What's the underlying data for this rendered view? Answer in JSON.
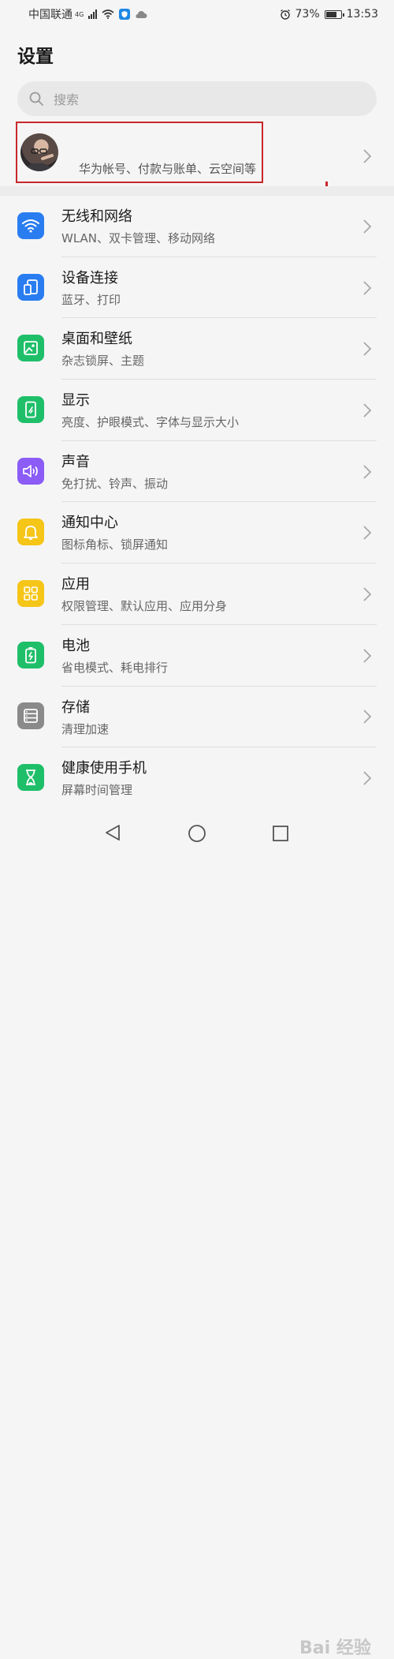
{
  "status_bar": {
    "carrier": "中国联通",
    "network": "4G",
    "battery_percent": "73%",
    "battery_level": 0.73,
    "time": "13:53",
    "icons": [
      "signal-icon",
      "wifi-icon",
      "shield-app-icon",
      "cloud-icon",
      "alarm-icon",
      "battery-icon"
    ]
  },
  "header": {
    "title": "设置"
  },
  "search": {
    "placeholder": "搜索"
  },
  "account": {
    "subtitle": "华为帐号、付款与账单、云空间等",
    "highlight_color": "#c8272c"
  },
  "watermark": {
    "text": "Bai 经验"
  },
  "settings": [
    {
      "title": "无线和网络",
      "subtitle": "WLAN、双卡管理、移动网络",
      "icon": "wifi-icon",
      "color": "#2a7df0"
    },
    {
      "title": "设备连接",
      "subtitle": "蓝牙、打印",
      "icon": "device-connection-icon",
      "color": "#2a7df0"
    },
    {
      "title": "桌面和壁纸",
      "subtitle": "杂志锁屏、主题",
      "icon": "wallpaper-icon",
      "color": "#1fbf6a"
    },
    {
      "title": "显示",
      "subtitle": "亮度、护眼模式、字体与显示大小",
      "icon": "display-icon",
      "color": "#1fbf6a"
    },
    {
      "title": "声音",
      "subtitle": "免打扰、铃声、振动",
      "icon": "sound-icon",
      "color": "#8b5cf6"
    },
    {
      "title": "通知中心",
      "subtitle": "图标角标、锁屏通知",
      "icon": "bell-icon",
      "color": "#f5c518"
    },
    {
      "title": "应用",
      "subtitle": "权限管理、默认应用、应用分身",
      "icon": "apps-grid-icon",
      "color": "#f5c518"
    },
    {
      "title": "电池",
      "subtitle": "省电模式、耗电排行",
      "icon": "battery-settings-icon",
      "color": "#1fbf6a"
    },
    {
      "title": "存储",
      "subtitle": "清理加速",
      "icon": "storage-icon",
      "color": "#8a8a8a"
    },
    {
      "title": "健康使用手机",
      "subtitle": "屏幕时间管理",
      "icon": "hourglass-icon",
      "color": "#1fbf6a"
    }
  ],
  "navigation": {
    "buttons": [
      "back-button",
      "home-button",
      "recents-button"
    ]
  }
}
